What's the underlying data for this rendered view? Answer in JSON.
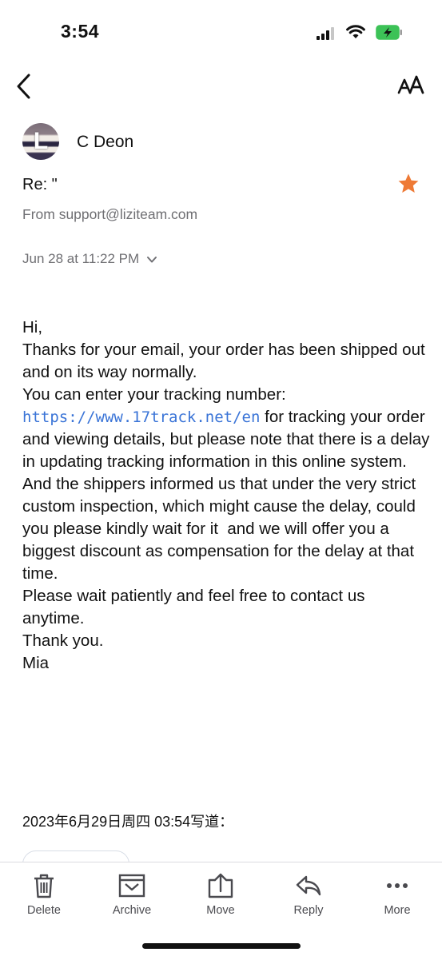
{
  "status_bar": {
    "time": "3:54"
  },
  "nav": {
    "back_icon": "chevron-left-icon",
    "font_size_icon": "text-size-icon"
  },
  "message": {
    "avatar_letter": "L",
    "sender_name": "C Deon",
    "subject": "Re: \"",
    "from": "From support@liziteam.com",
    "date": "Jun 28 at 11:22 PM",
    "starred": true,
    "star_color": "#ee7a36",
    "body_intro": "Hi,\nThanks for your email, your order has been shipped out and on its way normally.\nYou can enter your tracking number:\n",
    "link": "https://www.17track.net/en",
    "body_after_link": " for tracking your order and viewing details, but please note that there is a delay in updating tracking information in this online system.\nAnd the shippers informed us that under the very strict custom inspection, which might cause the delay, could you please kindly wait for it  and we will offer you a biggest discount as compensation for the delay at that time.\nPlease wait patiently and feel free to contact us anytime.\nThank you.\nMia",
    "quote_header": "2023年6月29日周四 03:54写道："
  },
  "toolbar": {
    "delete": "Delete",
    "archive": "Archive",
    "move": "Move",
    "reply": "Reply",
    "more": "More"
  },
  "colors": {
    "link": "#3a74d7",
    "secondary_text": "#6f6f73",
    "star": "#ee7a36",
    "battery": "#3cc257"
  }
}
